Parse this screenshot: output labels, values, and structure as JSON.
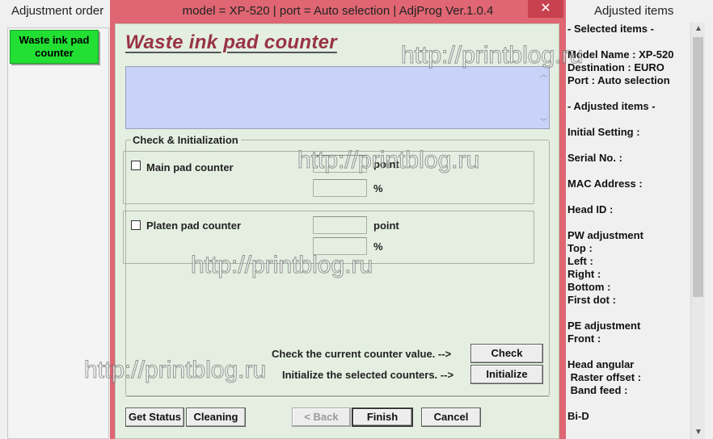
{
  "left_panel": {
    "title": "Adjustment order",
    "items": [
      {
        "label": "Waste ink pad counter"
      }
    ]
  },
  "dialog": {
    "title": "model = XP-520 | port = Auto selection | AdjProg Ver.1.0.4",
    "close_glyph": "✕",
    "heading": "Waste ink pad counter",
    "result_text": "",
    "group_label": "Check & Initialization",
    "main_pad": {
      "label": "Main pad counter",
      "point_value": "",
      "percent_value": "",
      "point_unit": "point",
      "percent_unit": "%"
    },
    "platen_pad": {
      "label": "Platen pad counter",
      "point_value": "",
      "percent_value": "",
      "point_unit": "point",
      "percent_unit": "%"
    },
    "check_instruction": "Check the current counter value. -->",
    "check_button": "Check",
    "init_instruction": "Initialize the selected counters. -->",
    "init_button": "Initialize",
    "footer": {
      "get_status": "Get Status",
      "cleaning": "Cleaning",
      "back": "< Back",
      "finish": "Finish",
      "cancel": "Cancel"
    }
  },
  "right_panel": {
    "title": "Adjusted items",
    "content": "- Selected items -\n\nModel Name : XP-520\nDestination : EURO\nPort : Auto selection\n\n- Adjusted items -\n\nInitial Setting :\n\nSerial No. :\n\nMAC Address :\n\nHead ID :\n\nPW adjustment\nTop :\nLeft :\nRight :\nBottom :\nFirst dot :\n\nPE adjustment\nFront :\n\nHead angular\n Raster offset :\n Band feed :\n\nBi-D"
  },
  "watermark": "http://printblog.ru",
  "colors": {
    "dialog_border": "#df6672",
    "dialog_client": "#e4efe1",
    "heading": "#993344",
    "result_box": "#c9d2f9",
    "selected_item": "#22e033",
    "close_button": "#c7424e"
  },
  "icons": {
    "close": "close-icon",
    "scroll_up": "chevron-up-icon",
    "scroll_down": "chevron-down-icon"
  }
}
